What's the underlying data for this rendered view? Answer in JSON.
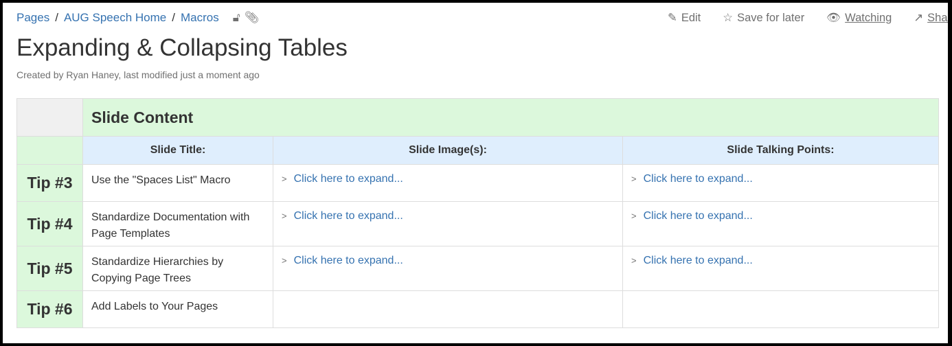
{
  "breadcrumb": [
    "Pages",
    "AUG Speech Home",
    "Macros"
  ],
  "breadcrumb_icons": [
    "unlock-icon",
    "paperclip-icon"
  ],
  "actions": [
    {
      "label": "Edit",
      "icon": "pencil-icon"
    },
    {
      "label": "Save for later",
      "icon": "star-icon"
    },
    {
      "label": "Watching",
      "icon": "eye-icon"
    },
    {
      "label": "Share",
      "icon": "share-icon"
    }
  ],
  "title": "Expanding & Collapsing Tables",
  "meta": "Created by Ryan Haney, last modified just a moment ago",
  "table": {
    "group_header": "Slide Content",
    "columns": [
      "Slide Title:",
      "Slide Image(s):",
      "Slide Talking Points:"
    ],
    "expand_label": "Click here to expand...",
    "rows": [
      {
        "tip": "Tip #3",
        "title": "Use the \"Spaces List\" Macro",
        "images": "Click here to expand...",
        "points": "Click here to expand..."
      },
      {
        "tip": "Tip #4",
        "title": "Standardize Documentation with Page Templates",
        "images": "Click here to expand...",
        "points": "Click here to expand..."
      },
      {
        "tip": "Tip #5",
        "title": "Standardize Hierarchies by Copying Page Trees",
        "images": "Click here to expand...",
        "points": "Click here to expand..."
      },
      {
        "tip": "Tip #6",
        "title": "Add Labels to Your Pages",
        "images": "",
        "points": ""
      }
    ]
  },
  "colors": {
    "link": "#3572b0",
    "green_header": "#dcf8dc",
    "blue_header": "#dfeefd"
  }
}
